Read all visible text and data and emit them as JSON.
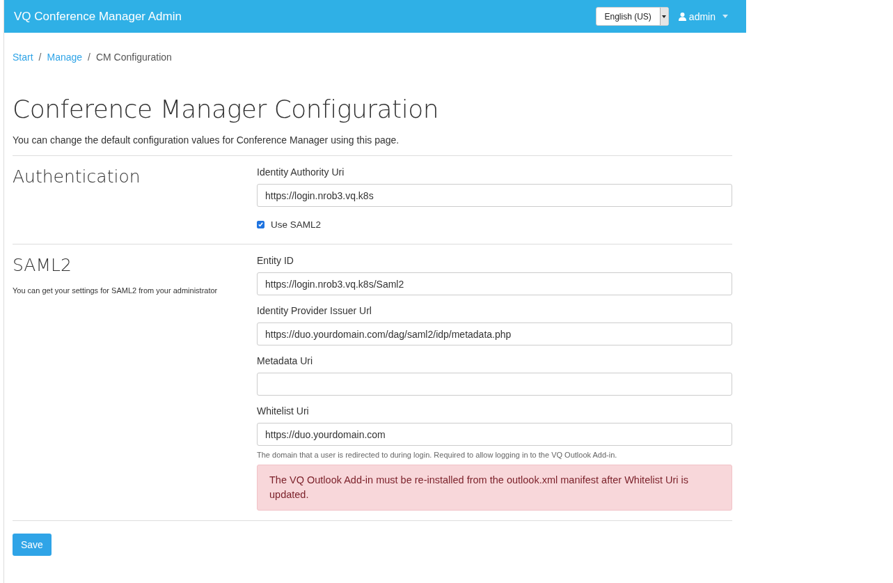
{
  "navbar": {
    "brand": "VQ Conference Manager Admin",
    "language": "English (US)",
    "user": "admin"
  },
  "breadcrumb": [
    {
      "kind": "link",
      "label": "Start"
    },
    {
      "kind": "separator",
      "label": "/"
    },
    {
      "kind": "link",
      "label": "Manage"
    },
    {
      "kind": "separator",
      "label": "/"
    },
    {
      "kind": "current",
      "label": "CM Configuration"
    }
  ],
  "title": "Conference Manager Configuration",
  "intro": "You can change the default configuration values for Conference Manager using this page.",
  "sections": [
    {
      "title": "Authentication",
      "fields": [
        {
          "kind": "text",
          "label": "Identity Authority Uri",
          "value": "https://login.nrob3.vq.k8s"
        },
        {
          "kind": "checkbox",
          "label": "Use SAML2",
          "checked": true
        }
      ]
    },
    {
      "title": "SAML2",
      "description": "You can get your settings for SAML2 from your administrator",
      "fields": [
        {
          "kind": "text",
          "label": "Entity ID",
          "value": "https://login.nrob3.vq.k8s/Saml2"
        },
        {
          "kind": "text",
          "label": "Identity Provider Issuer Url",
          "value": "https://duo.yourdomain.com/dag/saml2/idp/metadata.php"
        },
        {
          "kind": "text",
          "label": "Metadata Uri"
        },
        {
          "kind": "text",
          "label": "Whitelist Uri",
          "value": "https://duo.yourdomain.com",
          "help": "The domain that a user is redirected to during login. Required to allow logging in to the VQ Outlook Add-in.",
          "alert": "The VQ Outlook Add-in must be re-installed from the outlook.xml manifest after Whitelist Uri is updated."
        }
      ]
    }
  ],
  "save_button": "Save"
}
